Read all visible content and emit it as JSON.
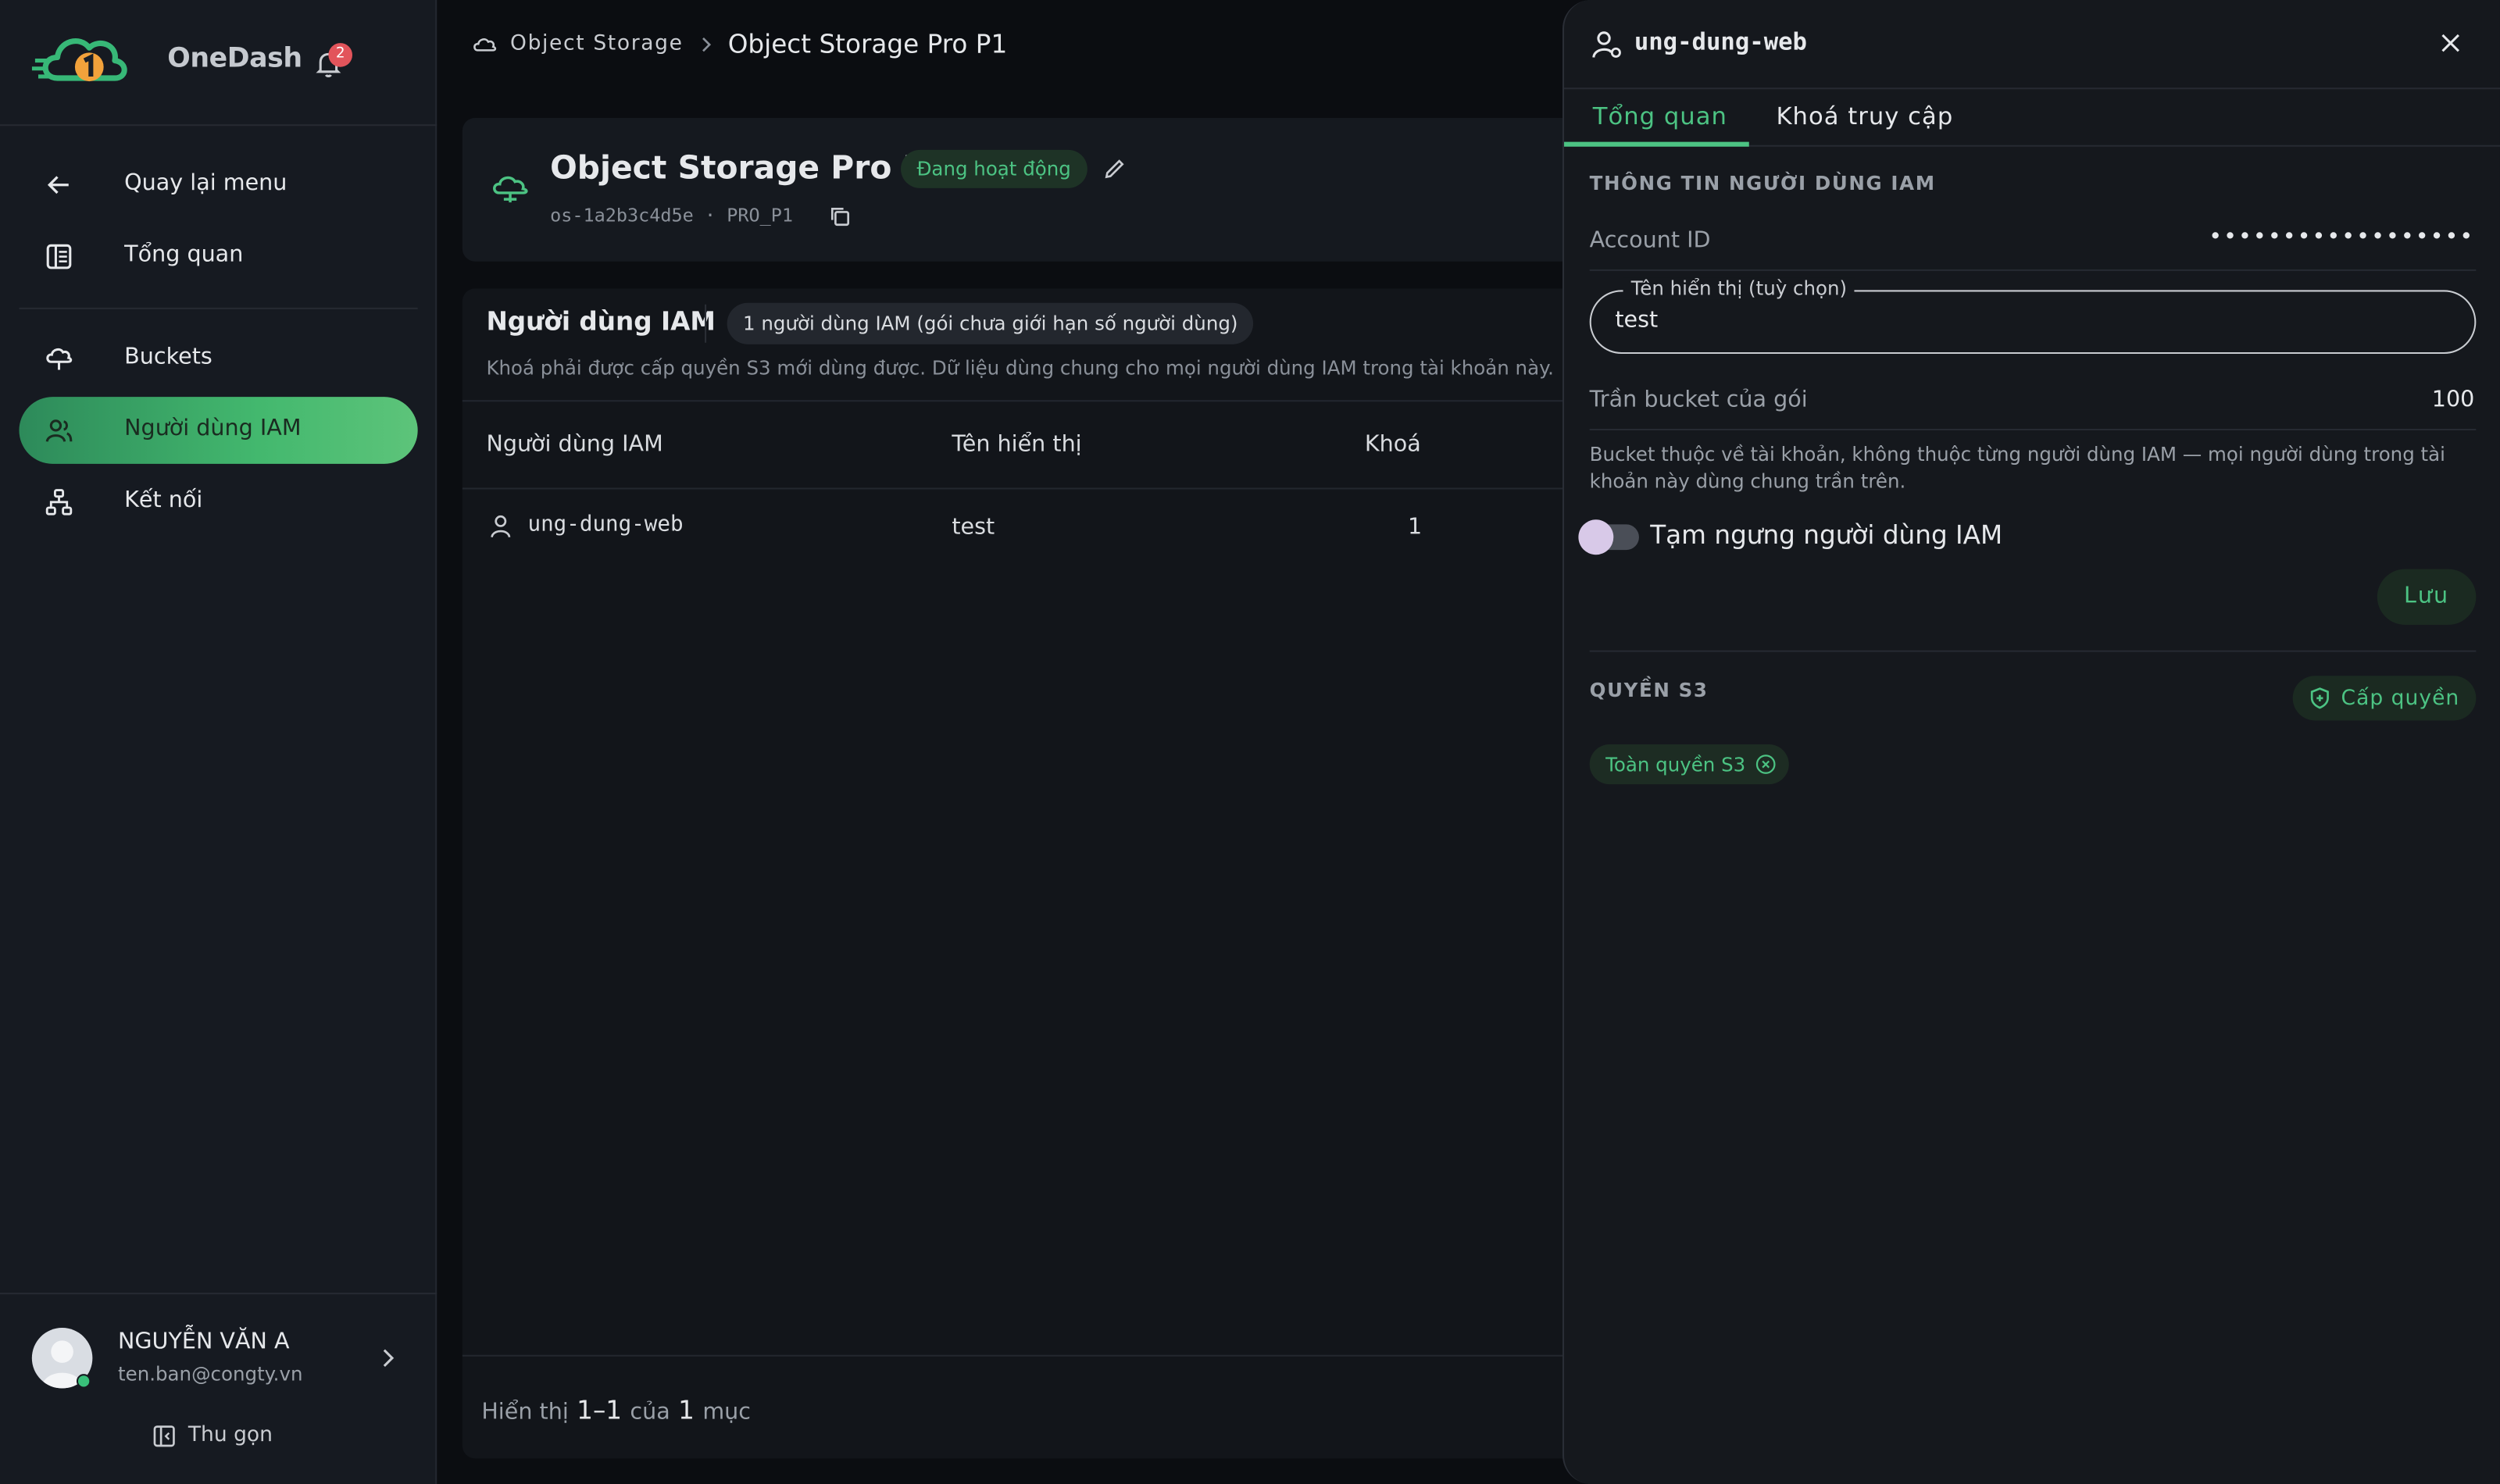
{
  "brand": {
    "name": "OneDash",
    "notification_count": "2"
  },
  "sidebar": {
    "items": [
      {
        "label": "Quay lại menu",
        "icon": "arrow-left-icon"
      },
      {
        "label": "Tổng quan",
        "icon": "dashboard-icon"
      },
      {
        "label": "Buckets",
        "icon": "bucket-icon"
      },
      {
        "label": "Người dùng IAM",
        "icon": "users-icon",
        "active": true
      },
      {
        "label": "Kết nối",
        "icon": "network-icon"
      }
    ],
    "user": {
      "name": "NGUYỄN VĂN A",
      "email": "ten.ban@congty.vn"
    },
    "collapse_label": "Thu gọn"
  },
  "breadcrumb": {
    "root": "Object Storage",
    "current": "Object Storage Pro P1"
  },
  "service": {
    "title": "Object Storage Pro P1",
    "status": "Đang hoạt động",
    "id": "os-1a2b3c4d5e",
    "plan": "PRO_P1"
  },
  "iam_table": {
    "title": "Người dùng IAM",
    "count_badge": "1 người dùng IAM (gói chưa giới hạn số người dùng)",
    "description": "Khoá phải được cấp quyền S3 mới dùng được. Dữ liệu dùng chung cho mọi người dùng IAM trong tài khoản này.",
    "columns": [
      "Người dùng IAM",
      "Tên hiển thị",
      "Khoá"
    ],
    "rows": [
      {
        "user": "ung-dung-web",
        "display_name": "test",
        "keys": "1"
      }
    ],
    "footer": {
      "prefix": "Hiển thị",
      "range": "1–1",
      "of": "của",
      "total": "1",
      "suffix": "mục"
    }
  },
  "drawer": {
    "title": "ung-dung-web",
    "tabs": [
      {
        "label": "Tổng quan",
        "active": true
      },
      {
        "label": "Khoá truy cập",
        "active": false
      }
    ],
    "info_section_title": "THÔNG TIN NGƯỜI DÙNG IAM",
    "account_id_label": "Account ID",
    "account_id_value": "••••••••••••••••••",
    "display_name_label": "Tên hiển thị (tuỳ chọn)",
    "display_name_value": "test",
    "bucket_limit_label": "Trần bucket của gói",
    "bucket_limit_value": "100",
    "help_text": "Bucket thuộc về tài khoản, không thuộc từng người dùng IAM — mọi người dùng trong tài khoản này dùng chung trần trên.",
    "suspend_label": "Tạm ngưng người dùng IAM",
    "suspend_on": false,
    "save_label": "Lưu",
    "s3_section_title": "QUYỀN S3",
    "grant_label": "Cấp quyền",
    "permissions": [
      "Toàn quyền S3"
    ]
  },
  "colors": {
    "accent": "#4cc383",
    "background": "#0b0d11",
    "badge": "#e2545b"
  }
}
